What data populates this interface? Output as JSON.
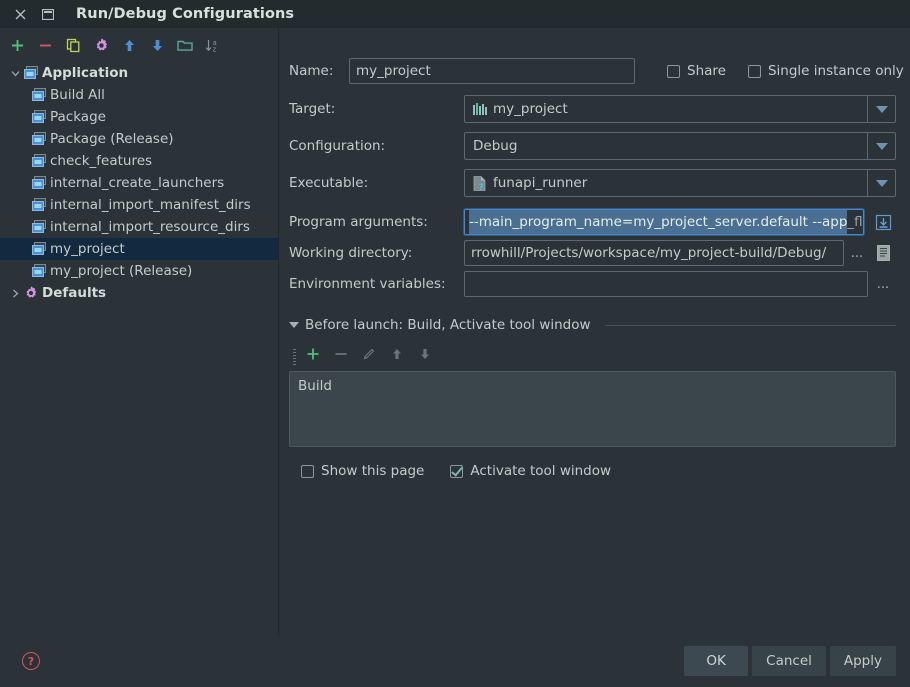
{
  "window": {
    "title": "Run/Debug Configurations",
    "close_icon": "close-icon",
    "menu_icon": "window-menu-icon"
  },
  "left_toolbar": {
    "items": [
      {
        "name": "add-configuration-button",
        "icon": "plus-icon",
        "color": "#4fc07a"
      },
      {
        "name": "remove-configuration-button",
        "icon": "minus-icon",
        "color": "#d8535f"
      },
      {
        "name": "copy-configuration-button",
        "icon": "copy-icon",
        "color": "#bdd356"
      },
      {
        "name": "edit-templates-button",
        "icon": "gear-icon",
        "color": "#d793e0"
      },
      {
        "name": "move-up-button",
        "icon": "arrow-up-icon",
        "color": "#4a90d9"
      },
      {
        "name": "move-down-button",
        "icon": "arrow-down-icon",
        "color": "#4a90d9"
      },
      {
        "name": "move-into-folder-button",
        "icon": "folder-icon",
        "color": "#57a99a"
      },
      {
        "name": "sort-alphabetically-button",
        "icon": "sort-az-icon",
        "color": "#8b9794"
      }
    ]
  },
  "tree": {
    "nodes": [
      {
        "label": "Application",
        "icon": "application-icon",
        "level": 0,
        "expanded": true,
        "group": true,
        "selected": false
      },
      {
        "label": "Build All",
        "icon": "run-config-icon",
        "level": 1,
        "selected": false
      },
      {
        "label": "Package",
        "icon": "run-config-icon",
        "level": 1,
        "selected": false
      },
      {
        "label": "Package (Release)",
        "icon": "run-config-icon",
        "level": 1,
        "selected": false
      },
      {
        "label": "check_features",
        "icon": "run-config-icon",
        "level": 1,
        "selected": false
      },
      {
        "label": "internal_create_launchers",
        "icon": "run-config-icon",
        "level": 1,
        "selected": false
      },
      {
        "label": "internal_import_manifest_dirs",
        "icon": "run-config-icon",
        "level": 1,
        "selected": false
      },
      {
        "label": "internal_import_resource_dirs",
        "icon": "run-config-icon",
        "level": 1,
        "selected": false
      },
      {
        "label": "my_project",
        "icon": "run-config-icon",
        "level": 1,
        "selected": true
      },
      {
        "label": "my_project (Release)",
        "icon": "run-config-icon",
        "level": 1,
        "selected": false
      },
      {
        "label": "Defaults",
        "icon": "defaults-gear-icon",
        "level": 0,
        "expanded": false,
        "group": true,
        "selected": false
      }
    ]
  },
  "form": {
    "name": {
      "label": "Name:",
      "label_mnemonic": "N",
      "value": "my_project"
    },
    "share": {
      "label": "Share",
      "checked": false
    },
    "single_instance": {
      "label": "Single instance only",
      "checked": false
    },
    "target": {
      "label": "Target:",
      "value": "my_project",
      "icon": "target-bars-icon"
    },
    "configuration": {
      "label": "Configuration:",
      "value": "Debug"
    },
    "executable": {
      "label": "Executable:",
      "value": "funapi_runner",
      "icon": "executable-file-icon"
    },
    "program_arguments": {
      "label": "Program arguments:",
      "label_mnemonic": "g",
      "value": "--main_program_name=my_project_server.default --app_fla",
      "selected_text": "--main_program_name=my_project_server.default --app",
      "focused": true,
      "expand_button_icon": "expand-editor-icon"
    },
    "working_directory": {
      "label": "Working directory:",
      "label_mnemonic": "W",
      "value": "rrowhill/Projects/workspace/my_project-build/Debug/",
      "browse_button_label": "...",
      "macro_button_icon": "insert-macro-icon"
    },
    "environment_variables": {
      "label": "Environment variables:",
      "label_mnemonic": "E",
      "value": "",
      "browse_button_label": "..."
    }
  },
  "before_launch": {
    "title": "Before launch: Build, Activate tool window",
    "expanded": true,
    "toolbar": [
      {
        "name": "before-launch-add-button",
        "icon": "plus-icon",
        "enabled": true
      },
      {
        "name": "before-launch-remove-button",
        "icon": "minus-icon",
        "enabled": false
      },
      {
        "name": "before-launch-edit-button",
        "icon": "pencil-icon",
        "enabled": false
      },
      {
        "name": "before-launch-move-up-button",
        "icon": "arrow-up-icon",
        "enabled": false
      },
      {
        "name": "before-launch-move-down-button",
        "icon": "arrow-down-icon",
        "enabled": false
      }
    ],
    "tasks": [
      {
        "label": "Build"
      }
    ],
    "show_this_page": {
      "label": "Show this page",
      "checked": false
    },
    "activate_tool_window": {
      "label": "Activate tool window",
      "checked": true
    }
  },
  "footer": {
    "help_icon": "help-icon",
    "ok_label": "OK",
    "cancel_label": "Cancel",
    "apply_label": "Apply"
  },
  "colors": {
    "background": "#2b3339",
    "titlebar": "#232b2f",
    "selection": "#12293f",
    "accent_green": "#4fc07a",
    "accent_red": "#d8535f",
    "focus_blue": "#4a88c7",
    "list_background": "#3a464c"
  }
}
